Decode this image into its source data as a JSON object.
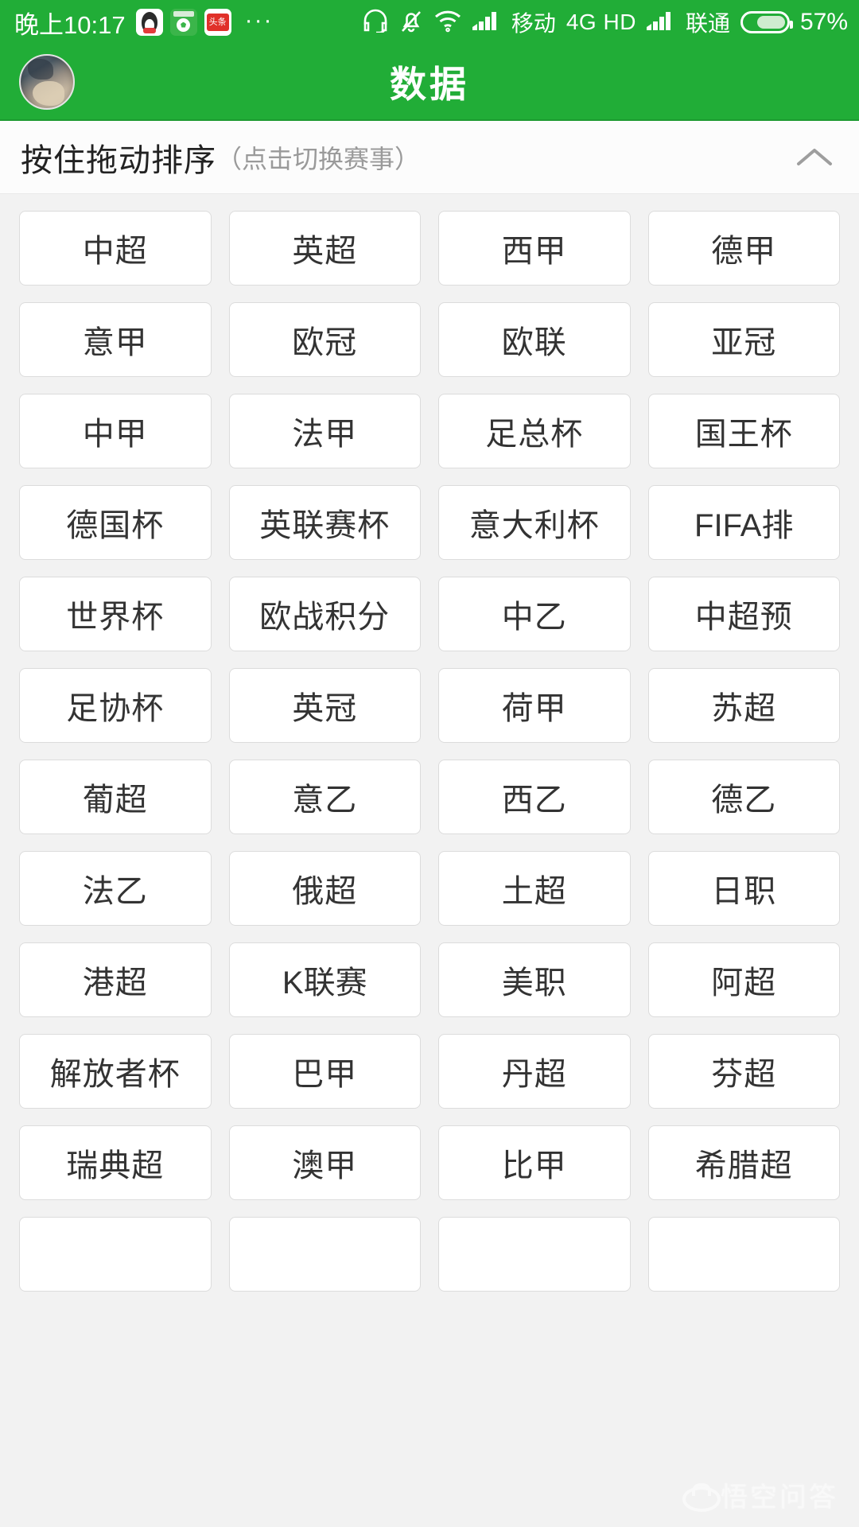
{
  "status_bar": {
    "time": "晚上10:17",
    "app_icons": [
      "qq-icon",
      "soccer-app-icon",
      "toutiao-icon"
    ],
    "overflow": "···",
    "icons": [
      "headset-icon",
      "silent-bell-icon",
      "wifi-icon",
      "signal-icon"
    ],
    "carrier_1": "移动",
    "network": "4G HD",
    "carrier_2": "联通",
    "battery_percent": "57%",
    "battery_level": 57,
    "background_color": "#21ad37"
  },
  "app_bar": {
    "title": "数据",
    "avatar": "user-avatar",
    "background_color": "#21ad37"
  },
  "hint_bar": {
    "main_text": "按住拖动排序",
    "sub_text": "（点击切换赛事）",
    "collapse_icon": "chevron-up-icon"
  },
  "league_grid": {
    "columns": 4,
    "items": [
      "中超",
      "英超",
      "西甲",
      "德甲",
      "意甲",
      "欧冠",
      "欧联",
      "亚冠",
      "中甲",
      "法甲",
      "足总杯",
      "国王杯",
      "德国杯",
      "英联赛杯",
      "意大利杯",
      "FIFA排",
      "世界杯",
      "欧战积分",
      "中乙",
      "中超预",
      "足协杯",
      "英冠",
      "荷甲",
      "苏超",
      "葡超",
      "意乙",
      "西乙",
      "德乙",
      "法乙",
      "俄超",
      "土超",
      "日职",
      "港超",
      "K联赛",
      "美职",
      "阿超",
      "解放者杯",
      "巴甲",
      "丹超",
      "芬超",
      "瑞典超",
      "澳甲",
      "比甲",
      "希腊超",
      "",
      "",
      "",
      ""
    ]
  },
  "watermark": {
    "text": "悟空问答",
    "logo": "wukong-logo"
  }
}
